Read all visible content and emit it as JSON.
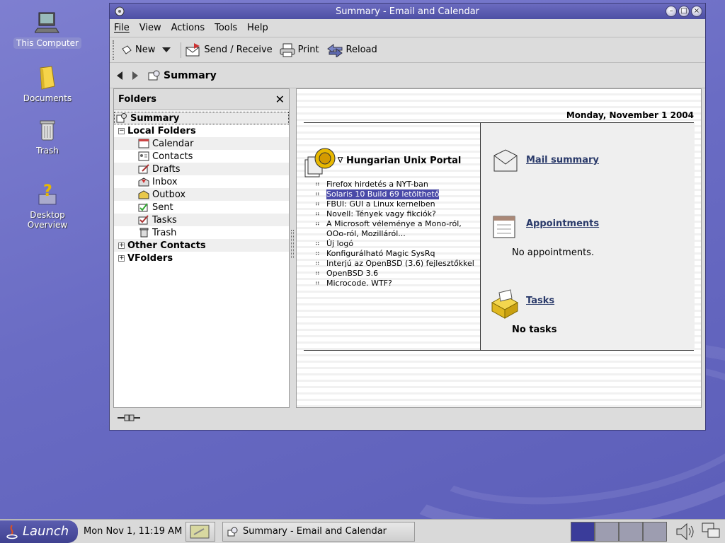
{
  "desktop": {
    "icons": [
      {
        "label": "This Computer"
      },
      {
        "label": "Documents"
      },
      {
        "label": "Trash"
      },
      {
        "label": "Desktop Overview"
      }
    ]
  },
  "window": {
    "title": "Summary - Email and Calendar",
    "menu": [
      "File",
      "View",
      "Actions",
      "Tools",
      "Help"
    ],
    "toolbar": {
      "new_label": "New",
      "send_receive_label": "Send / Receive",
      "print_label": "Print",
      "reload_label": "Reload"
    },
    "nav": {
      "title": "Summary"
    },
    "folders": {
      "header": "Folders",
      "items": [
        {
          "label": "Summary"
        },
        {
          "label": "Local Folders"
        },
        {
          "label": "Calendar"
        },
        {
          "label": "Contacts"
        },
        {
          "label": "Drafts"
        },
        {
          "label": "Inbox"
        },
        {
          "label": "Outbox"
        },
        {
          "label": "Sent"
        },
        {
          "label": "Tasks"
        },
        {
          "label": "Trash"
        },
        {
          "label": "Other Contacts"
        },
        {
          "label": "VFolders"
        }
      ]
    },
    "summary": {
      "date": "Monday, November 1 2004",
      "portal": {
        "title": "Hungarian Unix Portal",
        "items": [
          "Firefox hirdetés a NYT-ban",
          "Solaris 10 Build 69 letölthető",
          "FBUI: GUI a Linux kernelben",
          "Novell: Tények vagy fikciók?",
          "A Microsoft véleménye a Mono-ról, OOo-ról, Mozilláról...",
          "Új logó",
          "Konfigurálható Magic SysRq",
          "Interjú az OpenBSD (3.6) fejlesztőkkel",
          "OpenBSD 3.6",
          "Microcode. WTF?"
        ]
      },
      "mail_summary_label": "Mail summary",
      "appointments_label": "Appointments",
      "appointments_text": "No appointments.",
      "tasks_label": "Tasks",
      "tasks_text": "No tasks"
    }
  },
  "taskbar": {
    "launch_label": "Launch",
    "clock": "Mon Nov  1, 11:19 AM",
    "task_label": "Summary - Email and Calendar"
  }
}
